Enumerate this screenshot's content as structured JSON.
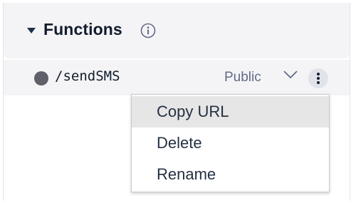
{
  "section": {
    "title": "Functions",
    "info_icon": "info-circle-icon",
    "collapse_icon": "caret-down-icon"
  },
  "function_row": {
    "path": "/sendSMS",
    "visibility": "Public",
    "status_icon": "status-dot-icon",
    "visibility_dropdown_icon": "chevron-down-icon",
    "more_icon": "more-vertical-icon"
  },
  "context_menu": {
    "items": [
      {
        "label": "Copy URL",
        "highlighted": true
      },
      {
        "label": "Delete",
        "highlighted": false
      },
      {
        "label": "Rename",
        "highlighted": false
      }
    ]
  },
  "colors": {
    "header_bg": "#f4f4f6",
    "title_text": "#121c2d",
    "secondary_text": "#606b85",
    "status_dot": "#5f6069",
    "menu_highlight": "#e6e6e6",
    "kebab_bg": "#e1e3ea"
  }
}
